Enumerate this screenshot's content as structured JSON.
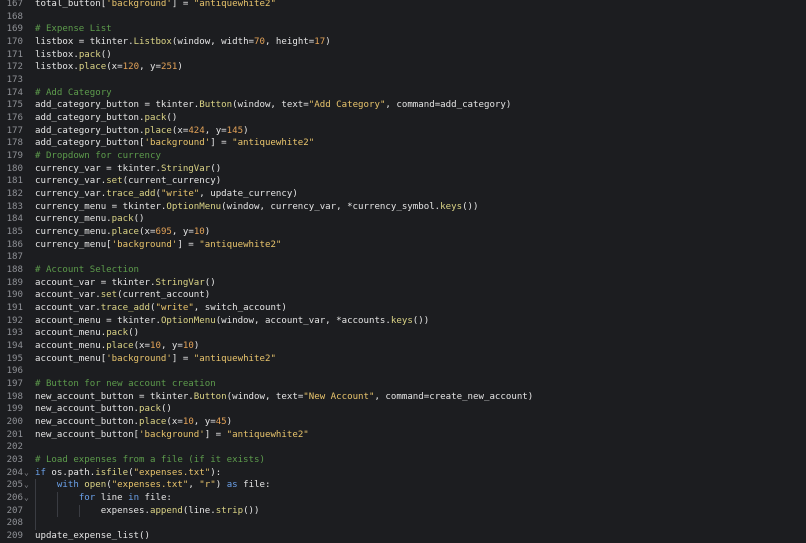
{
  "editor": {
    "language": "python",
    "theme": {
      "background": "#1c1d20",
      "text": "#e4e4e4",
      "line_number": "#8f9196",
      "comment": "#5d9c4c",
      "string": "#e8c46c",
      "number": "#e2a258",
      "keyword": "#6aa0e8",
      "function": "#dbd486"
    },
    "lines": [
      {
        "n": "167",
        "fold": "",
        "tokens": [
          [
            "total_button[",
            "pl"
          ],
          [
            "'background'",
            "st"
          ],
          [
            "] = ",
            "pl"
          ],
          [
            "\"antiquewhite2\"",
            "st"
          ]
        ]
      },
      {
        "n": "168",
        "fold": "",
        "tokens": []
      },
      {
        "n": "169",
        "fold": "",
        "tokens": [
          [
            "# Expense List",
            "cm"
          ]
        ]
      },
      {
        "n": "170",
        "fold": "",
        "tokens": [
          [
            "listbox = tkinter.",
            "pl"
          ],
          [
            "Listbox",
            "fn"
          ],
          [
            "(window, width=",
            "pl"
          ],
          [
            "70",
            "nu"
          ],
          [
            ", height=",
            "pl"
          ],
          [
            "17",
            "nu"
          ],
          [
            ")",
            "pl"
          ]
        ]
      },
      {
        "n": "171",
        "fold": "",
        "tokens": [
          [
            "listbox.",
            "pl"
          ],
          [
            "pack",
            "fn"
          ],
          [
            "()",
            "pl"
          ]
        ]
      },
      {
        "n": "172",
        "fold": "",
        "tokens": [
          [
            "listbox.",
            "pl"
          ],
          [
            "place",
            "fn"
          ],
          [
            "(x=",
            "pl"
          ],
          [
            "120",
            "nu"
          ],
          [
            ", y=",
            "pl"
          ],
          [
            "251",
            "nu"
          ],
          [
            ")",
            "pl"
          ]
        ]
      },
      {
        "n": "173",
        "fold": "",
        "tokens": []
      },
      {
        "n": "174",
        "fold": "",
        "tokens": [
          [
            "# Add Category",
            "cm"
          ]
        ]
      },
      {
        "n": "175",
        "fold": "",
        "tokens": [
          [
            "add_category_button = tkinter.",
            "pl"
          ],
          [
            "Button",
            "fn"
          ],
          [
            "(window, text=",
            "pl"
          ],
          [
            "\"Add Category\"",
            "st"
          ],
          [
            ", command=add_category)",
            "pl"
          ]
        ]
      },
      {
        "n": "176",
        "fold": "",
        "tokens": [
          [
            "add_category_button.",
            "pl"
          ],
          [
            "pack",
            "fn"
          ],
          [
            "()",
            "pl"
          ]
        ]
      },
      {
        "n": "177",
        "fold": "",
        "tokens": [
          [
            "add_category_button.",
            "pl"
          ],
          [
            "place",
            "fn"
          ],
          [
            "(x=",
            "pl"
          ],
          [
            "424",
            "nu"
          ],
          [
            ", y=",
            "pl"
          ],
          [
            "145",
            "nu"
          ],
          [
            ")",
            "pl"
          ]
        ]
      },
      {
        "n": "178",
        "fold": "",
        "tokens": [
          [
            "add_category_button[",
            "pl"
          ],
          [
            "'background'",
            "st"
          ],
          [
            "] = ",
            "pl"
          ],
          [
            "\"antiquewhite2\"",
            "st"
          ]
        ]
      },
      {
        "n": "179",
        "fold": "",
        "tokens": [
          [
            "# Dropdown for currency",
            "cm"
          ]
        ]
      },
      {
        "n": "180",
        "fold": "",
        "tokens": [
          [
            "currency_var = tkinter.",
            "pl"
          ],
          [
            "StringVar",
            "fn"
          ],
          [
            "()",
            "pl"
          ]
        ]
      },
      {
        "n": "181",
        "fold": "",
        "tokens": [
          [
            "currency_var.",
            "pl"
          ],
          [
            "set",
            "fn"
          ],
          [
            "(current_currency)",
            "pl"
          ]
        ]
      },
      {
        "n": "182",
        "fold": "",
        "tokens": [
          [
            "currency_var.",
            "pl"
          ],
          [
            "trace_add",
            "fn"
          ],
          [
            "(",
            "pl"
          ],
          [
            "\"write\"",
            "st"
          ],
          [
            ", update_currency)",
            "pl"
          ]
        ]
      },
      {
        "n": "183",
        "fold": "",
        "tokens": [
          [
            "currency_menu = tkinter.",
            "pl"
          ],
          [
            "OptionMenu",
            "fn"
          ],
          [
            "(window, currency_var, *currency_symbol.",
            "pl"
          ],
          [
            "keys",
            "fn"
          ],
          [
            "())",
            "pl"
          ]
        ]
      },
      {
        "n": "184",
        "fold": "",
        "tokens": [
          [
            "currency_menu.",
            "pl"
          ],
          [
            "pack",
            "fn"
          ],
          [
            "()",
            "pl"
          ]
        ]
      },
      {
        "n": "185",
        "fold": "",
        "tokens": [
          [
            "currency_menu.",
            "pl"
          ],
          [
            "place",
            "fn"
          ],
          [
            "(x=",
            "pl"
          ],
          [
            "695",
            "nu"
          ],
          [
            ", y=",
            "pl"
          ],
          [
            "10",
            "nu"
          ],
          [
            ")",
            "pl"
          ]
        ]
      },
      {
        "n": "186",
        "fold": "",
        "tokens": [
          [
            "currency_menu[",
            "pl"
          ],
          [
            "'background'",
            "st"
          ],
          [
            "] = ",
            "pl"
          ],
          [
            "\"antiquewhite2\"",
            "st"
          ]
        ]
      },
      {
        "n": "187",
        "fold": "",
        "tokens": []
      },
      {
        "n": "188",
        "fold": "",
        "tokens": [
          [
            "# Account Selection",
            "cm"
          ]
        ]
      },
      {
        "n": "189",
        "fold": "",
        "tokens": [
          [
            "account_var = tkinter.",
            "pl"
          ],
          [
            "StringVar",
            "fn"
          ],
          [
            "()",
            "pl"
          ]
        ]
      },
      {
        "n": "190",
        "fold": "",
        "tokens": [
          [
            "account_var.",
            "pl"
          ],
          [
            "set",
            "fn"
          ],
          [
            "(current_account)",
            "pl"
          ]
        ]
      },
      {
        "n": "191",
        "fold": "",
        "tokens": [
          [
            "account_var.",
            "pl"
          ],
          [
            "trace_add",
            "fn"
          ],
          [
            "(",
            "pl"
          ],
          [
            "\"write\"",
            "st"
          ],
          [
            ", switch_account)",
            "pl"
          ]
        ]
      },
      {
        "n": "192",
        "fold": "",
        "tokens": [
          [
            "account_menu = tkinter.",
            "pl"
          ],
          [
            "OptionMenu",
            "fn"
          ],
          [
            "(window, account_var, *accounts.",
            "pl"
          ],
          [
            "keys",
            "fn"
          ],
          [
            "())",
            "pl"
          ]
        ]
      },
      {
        "n": "193",
        "fold": "",
        "tokens": [
          [
            "account_menu.",
            "pl"
          ],
          [
            "pack",
            "fn"
          ],
          [
            "()",
            "pl"
          ]
        ]
      },
      {
        "n": "194",
        "fold": "",
        "tokens": [
          [
            "account_menu.",
            "pl"
          ],
          [
            "place",
            "fn"
          ],
          [
            "(x=",
            "pl"
          ],
          [
            "10",
            "nu"
          ],
          [
            ", y=",
            "pl"
          ],
          [
            "10",
            "nu"
          ],
          [
            ")",
            "pl"
          ]
        ]
      },
      {
        "n": "195",
        "fold": "",
        "tokens": [
          [
            "account_menu[",
            "pl"
          ],
          [
            "'background'",
            "st"
          ],
          [
            "] = ",
            "pl"
          ],
          [
            "\"antiquewhite2\"",
            "st"
          ]
        ]
      },
      {
        "n": "196",
        "fold": "",
        "tokens": []
      },
      {
        "n": "197",
        "fold": "",
        "tokens": [
          [
            "# Button for new account creation",
            "cm"
          ]
        ]
      },
      {
        "n": "198",
        "fold": "",
        "tokens": [
          [
            "new_account_button = tkinter.",
            "pl"
          ],
          [
            "Button",
            "fn"
          ],
          [
            "(window, text=",
            "pl"
          ],
          [
            "\"New Account\"",
            "st"
          ],
          [
            ", command=create_new_account)",
            "pl"
          ]
        ]
      },
      {
        "n": "199",
        "fold": "",
        "tokens": [
          [
            "new_account_button.",
            "pl"
          ],
          [
            "pack",
            "fn"
          ],
          [
            "()",
            "pl"
          ]
        ]
      },
      {
        "n": "200",
        "fold": "",
        "tokens": [
          [
            "new_account_button.",
            "pl"
          ],
          [
            "place",
            "fn"
          ],
          [
            "(x=",
            "pl"
          ],
          [
            "10",
            "nu"
          ],
          [
            ", y=",
            "pl"
          ],
          [
            "45",
            "nu"
          ],
          [
            ")",
            "pl"
          ]
        ]
      },
      {
        "n": "201",
        "fold": "",
        "tokens": [
          [
            "new_account_button[",
            "pl"
          ],
          [
            "'background'",
            "st"
          ],
          [
            "] = ",
            "pl"
          ],
          [
            "\"antiquewhite2\"",
            "st"
          ]
        ]
      },
      {
        "n": "202",
        "fold": "",
        "tokens": []
      },
      {
        "n": "203",
        "fold": "",
        "tokens": [
          [
            "# Load expenses from a file (if it exists)",
            "cm"
          ]
        ]
      },
      {
        "n": "204",
        "fold": "⌄",
        "tokens": [
          [
            "if",
            "kw"
          ],
          [
            " os.path.",
            "pl"
          ],
          [
            "isfile",
            "fn"
          ],
          [
            "(",
            "pl"
          ],
          [
            "\"expenses.txt\"",
            "st"
          ],
          [
            "):",
            "pl"
          ]
        ]
      },
      {
        "n": "205",
        "fold": "⌄",
        "tokens": [
          [
            "    ",
            "pl"
          ],
          [
            "with",
            "kw"
          ],
          [
            " ",
            "pl"
          ],
          [
            "open",
            "fn"
          ],
          [
            "(",
            "pl"
          ],
          [
            "\"expenses.txt\"",
            "st"
          ],
          [
            ", ",
            "pl"
          ],
          [
            "\"r\"",
            "st"
          ],
          [
            ") ",
            "pl"
          ],
          [
            "as",
            "kw"
          ],
          [
            " file:",
            "pl"
          ]
        ]
      },
      {
        "n": "206",
        "fold": "⌄",
        "tokens": [
          [
            "        ",
            "pl"
          ],
          [
            "for",
            "kw"
          ],
          [
            " line ",
            "pl"
          ],
          [
            "in",
            "kw"
          ],
          [
            " file:",
            "pl"
          ]
        ]
      },
      {
        "n": "207",
        "fold": "",
        "tokens": [
          [
            "            expenses.",
            "pl"
          ],
          [
            "append",
            "fn"
          ],
          [
            "(line.",
            "pl"
          ],
          [
            "strip",
            "fn"
          ],
          [
            "())",
            "pl"
          ]
        ]
      },
      {
        "n": "208",
        "fold": "",
        "tokens": []
      },
      {
        "n": "209",
        "fold": "",
        "tokens": [
          [
            "update_expense_list",
            "pl"
          ],
          [
            "()",
            "pl"
          ]
        ]
      }
    ]
  }
}
